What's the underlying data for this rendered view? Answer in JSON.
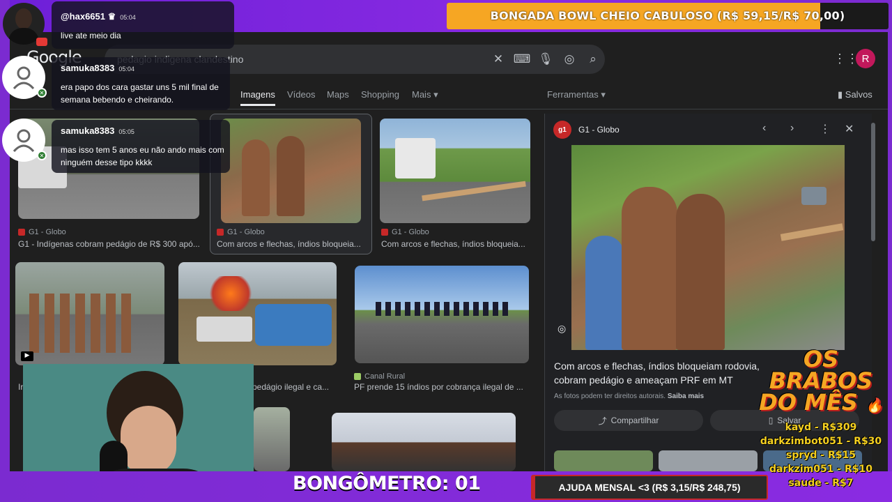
{
  "top_goal": {
    "text": "BONGADA BOWL CHEIO CABULOSO (R$ 59,15/R$ 70,00)",
    "progress": 0.845
  },
  "google": {
    "logo": "Google",
    "query": "pedagio indigena clandestino",
    "avatar_letter": "R",
    "tabs": [
      "Imagens",
      "Vídeos",
      "Maps",
      "Shopping",
      "Mais"
    ],
    "tools": "Ferramentas",
    "saved": "Salvos"
  },
  "results": [
    {
      "source": "G1 - Globo",
      "caption": "G1 - Indígenas cobram pedágio de R$ 300 apó..."
    },
    {
      "source": "G1 - Globo",
      "caption": "Com arcos e flechas, índios bloqueia..."
    },
    {
      "source": "G1 - Globo",
      "caption": "Com arcos e flechas, índios bloqueia..."
    },
    {
      "source": "",
      "caption": "Ir"
    },
    {
      "source": "",
      "caption": "pedágio ilegal e ca..."
    },
    {
      "source": "Canal Rural",
      "caption": "PF prende 15 índios por cobrança ilegal de ..."
    }
  ],
  "panel": {
    "source": "G1 - Globo",
    "title": "Com arcos e flechas, índios bloqueiam rodovia, cobram pedágio e ameaçam PRF em MT",
    "rights": "As fotos podem ter direitos autorais.",
    "learn_more": "Saiba mais",
    "share": "Compartilhar",
    "save": "Salvar"
  },
  "chat": [
    {
      "user": "@hax6651",
      "time": "05:04",
      "text": "live ate meio dia"
    },
    {
      "user": "samuka8383",
      "time": "05:04",
      "text": "era papo dos cara gastar uns 5 mil final de semana bebendo e cheirando."
    },
    {
      "user": "samuka8383",
      "time": "05:05",
      "text": "mas isso tem 5 anos eu não ando mais com ninguém desse tipo kkkk"
    }
  ],
  "bongometro": "BONGÔMETRO: 01",
  "monthly_goal": {
    "text": "AJUDA MENSAL <3 (R$ 3,15/R$ 248,75)",
    "progress": 0.013
  },
  "brabos": {
    "title_lines": [
      "OS",
      "BRABOS",
      "DO MÊS"
    ],
    "entries": [
      "kayd - R$309",
      "darkzimbot051 - R$30",
      "spryd - R$15",
      "darkzim051 - R$10",
      "saude - R$7"
    ]
  }
}
